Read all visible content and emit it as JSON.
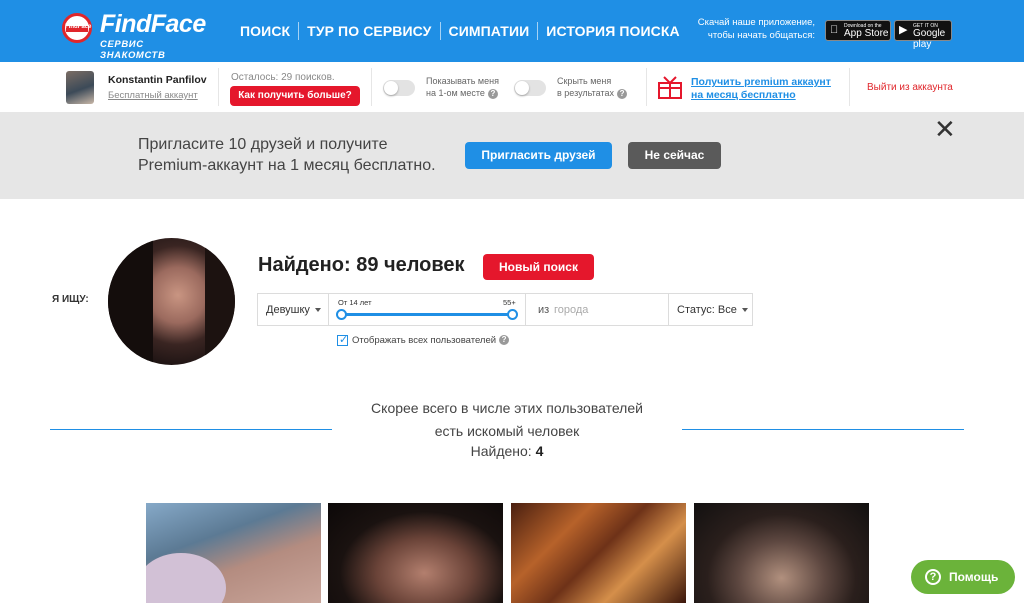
{
  "header": {
    "logo_title": "FindFace",
    "logo_subtitle": "СЕРВИС ЗНАКОМСТВ",
    "logo_badge": "FindFace",
    "nav": [
      {
        "label": "ПОИСК"
      },
      {
        "label": "ТУР ПО СЕРВИСУ"
      },
      {
        "label": "СИМПАТИИ"
      },
      {
        "label": "ИСТОРИЯ ПОИСКА"
      }
    ],
    "app_prompt_line1": "Скачай наше приложение,",
    "app_prompt_line2": "чтобы начать общаться:",
    "appstore_small": "Download on the",
    "appstore_big": "App Store",
    "googleplay_small": "GET IT ON",
    "googleplay_big": "Google play"
  },
  "userbar": {
    "user_name": "Konstantin Panfilov",
    "account_type": "Бесплатный аккаунт",
    "remaining": "Осталось: 29 поисков.",
    "get_more": "Как получить больше?",
    "toggle1_line1": "Показывать меня",
    "toggle1_line2": "на 1-ом месте",
    "toggle2_line1": "Скрыть меня",
    "toggle2_line2": "в результатах",
    "premium_line1": "Получить premium аккаунт",
    "premium_line2": "на месяц бесплатно",
    "logout": "Выйти из аккаунта"
  },
  "banner": {
    "line1": "Пригласите 10 друзей и получите",
    "line2": "Premium-аккаунт на 1 месяц бесплатно.",
    "invite_button": "Пригласить друзей",
    "later_button": "Не сейчас"
  },
  "search": {
    "i_search_label": "Я ИЩУ:",
    "found_title": "Найдено: 89 человек",
    "new_search": "Новый поиск",
    "gender": "Девушку",
    "age_from": "От 14 лет",
    "age_to": "55+",
    "age_range": [
      14,
      55
    ],
    "city_prefix": "из",
    "city_placeholder": "города",
    "status": "Статус: Все",
    "show_all": "Отображать всех пользователей",
    "show_all_checked": true
  },
  "results": {
    "line1": "Скорее всего в числе этих пользователей",
    "line2": "есть искомый человек",
    "found_label": "Найдено:",
    "found_count": "4"
  },
  "help": {
    "label": "Помощь"
  },
  "colors": {
    "brand_blue": "#1f8fe5",
    "accent_red": "#e5172c",
    "help_green": "#6bb33a"
  }
}
